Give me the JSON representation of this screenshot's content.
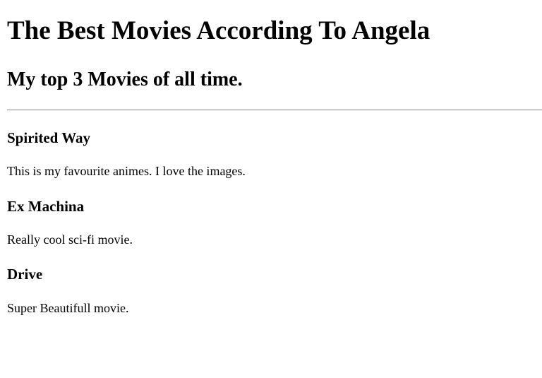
{
  "page": {
    "title": "The Best Movies According To Angela",
    "subtitle": "My top 3 Movies of all time."
  },
  "movies": [
    {
      "title": "Spirited Way",
      "description": "This is my favourite animes. I love the images."
    },
    {
      "title": "Ex Machina",
      "description": "Really cool sci-fi movie."
    },
    {
      "title": "Drive",
      "description": "Super Beautifull movie."
    }
  ]
}
